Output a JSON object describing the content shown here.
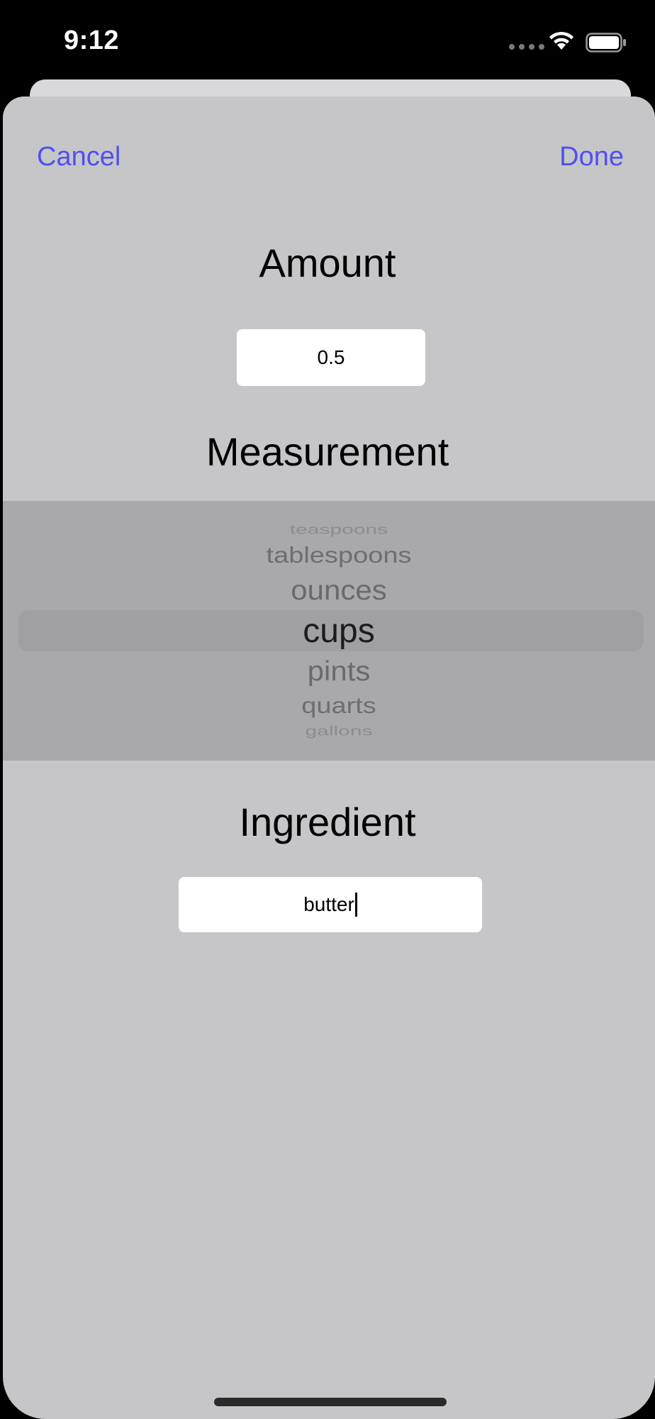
{
  "status_bar": {
    "time": "9:12",
    "icons": [
      "cellular-signal-icon",
      "wifi-icon",
      "battery-icon"
    ]
  },
  "nav": {
    "cancel_label": "Cancel",
    "done_label": "Done",
    "accent_color": "#5050f0"
  },
  "amount": {
    "title": "Amount",
    "value": "0.5"
  },
  "measurement": {
    "title": "Measurement",
    "options": [
      "teaspoons",
      "tablespoons",
      "ounces",
      "cups",
      "pints",
      "quarts",
      "gallons"
    ],
    "selected": "cups"
  },
  "ingredient": {
    "title": "Ingredient",
    "value": "butter"
  }
}
